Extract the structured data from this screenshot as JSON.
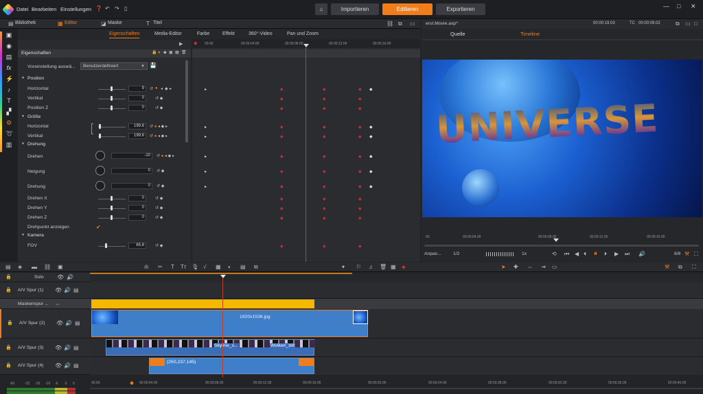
{
  "app": {
    "menu": [
      "Datei",
      "Bearbeiten",
      "Einstellungen"
    ],
    "nav": [
      "Importieren",
      "Editieren",
      "Exportieren"
    ],
    "active_nav": "Editieren"
  },
  "tabs": {
    "top": [
      "Bibliothek",
      "Editor",
      "Maske",
      "Titel"
    ],
    "sub": [
      "Eigenschaften",
      "Media-Editor",
      "Farbe",
      "Effekt",
      "360°-Video",
      "Pan und Zoom"
    ]
  },
  "props": {
    "title": "Eigenschaften",
    "preset_label": "Voreinstellung auswä...",
    "preset_value": "Benutzerdefiniert",
    "sections": {
      "position": "Position",
      "size": "Größe",
      "rotation": "Drehung",
      "camera": "Kamera"
    },
    "rows": {
      "horizontal": "Horizontal",
      "vertical": "Vertikal",
      "position_z": "Position Z",
      "size_h": "Horizontal",
      "size_v": "Vertikal",
      "drehen": "Drehen",
      "neigung": "Neigung",
      "drehung": "Drehung",
      "drehen_x": "Drehen X",
      "drehen_y": "Drehen Y",
      "drehen_z": "Drehen Z",
      "pivot": "Drehpunkt anzeigen",
      "fov": "FOV"
    },
    "values": {
      "horizontal": "9",
      "vertical": "0",
      "position_z": "0",
      "size_h": "199.6",
      "size_v": "199.6",
      "drehen": "-10",
      "neigung": "0",
      "drehung": "0",
      "drehen_x": "0",
      "drehen_y": "0",
      "drehen_z": "0",
      "fov": "65.8"
    }
  },
  "kf_ruler": [
    "00:00",
    "00:00:04:00",
    "00:00:08:00",
    "00:00:12:00",
    "00:00:16:00"
  ],
  "preview": {
    "filename": "erst.Movie.axp*",
    "timecode1": "00:00:19.03",
    "tc_label": "TC",
    "timecode2": "00:00:09.02",
    "tabs": [
      "Quelle",
      "Timeline"
    ],
    "active_tab": "Timeline",
    "ruler": [
      "00",
      "00:00:04.00",
      "00:00:08.00",
      "00:00:12.00",
      "00:00:16.00"
    ],
    "fit": "Anpas...",
    "ratio": "1/2",
    "speed": "1x",
    "bitrate": "8/8",
    "video_text": "UNIVERSE"
  },
  "timeline": {
    "solo": "Solo",
    "tracks": [
      "A/V Spur (1)",
      "Maskenspur ...",
      "A/V Spur (2)",
      "A/V Spur (3)",
      "A/V Spur (4)"
    ],
    "clips": {
      "main": "1920x1536.jpg",
      "skyline": "Skyline_s...",
      "wolken": "Wolken_bilt",
      "color": "(250,237,145)"
    },
    "ruler": [
      "00.00",
      "00:00:04.00",
      "00:00:08.00",
      "00:00:12.00",
      "00:00:16.00",
      "00:00:20.00",
      "00:00:24.00",
      "00:00:28.00",
      "00:00:32.00",
      "00:00:36.00",
      "00:00:40.00"
    ],
    "meter": [
      "-60",
      "-22",
      "-16",
      "-10",
      "-6",
      "-3",
      "0"
    ]
  },
  "colors": {
    "accent": "#f07d1a",
    "keyframe": "#d03030"
  }
}
